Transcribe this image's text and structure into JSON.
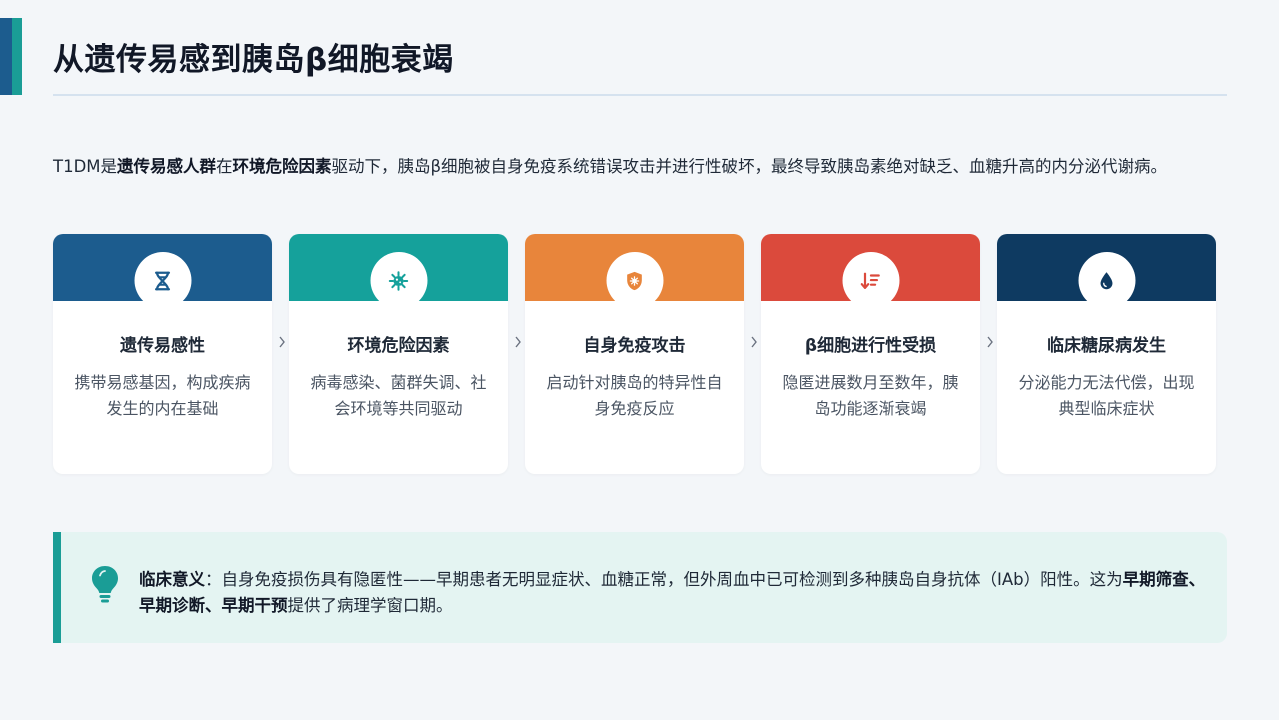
{
  "header": {
    "title": "从遗传易感到胰岛β细胞衰竭"
  },
  "intro": {
    "t1": "T1DM是",
    "b1": "遗传易感人群",
    "t2": "在",
    "b2": "环境危险因素",
    "t3": "驱动下，胰岛β细胞被自身免疫系统错误攻击并进行性破坏，最终导致胰岛素绝对缺乏、血糖升高的内分泌代谢病。"
  },
  "cards": [
    {
      "title": "遗传易感性",
      "desc": "携带易感基因，构成疾病发生的内在基础",
      "color": "#1c5c8e",
      "icon": "dna-icon"
    },
    {
      "title": "环境危险因素",
      "desc": "病毒感染、菌群失调、社会环境等共同驱动",
      "color": "#15a19b",
      "icon": "virus-icon"
    },
    {
      "title": "自身免疫攻击",
      "desc": "启动针对胰岛的特异性自身免疫反应",
      "color": "#e8853b",
      "icon": "shield-virus-icon"
    },
    {
      "title": "β细胞进行性受损",
      "desc": "隐匿进展数月至数年，胰岛功能逐渐衰竭",
      "color": "#db4a3c",
      "icon": "sort-descending-icon"
    },
    {
      "title": "临床糖尿病发生",
      "desc": "分泌能力无法代偿，出现典型临床症状",
      "color": "#0e3a61",
      "icon": "droplet-icon"
    }
  ],
  "note": {
    "label": "临床意义",
    "t1": "：自身免疫损伤具有隐匿性——早期患者无明显症状、血糖正常，但外周血中已可检测到多种胰岛自身抗体（IAb）阳性。这为",
    "bold": "早期筛查、早期诊断、早期干预",
    "t2": "提供了病理学窗口期。",
    "icon": "lightbulb-icon",
    "color": "#1a9d96"
  }
}
